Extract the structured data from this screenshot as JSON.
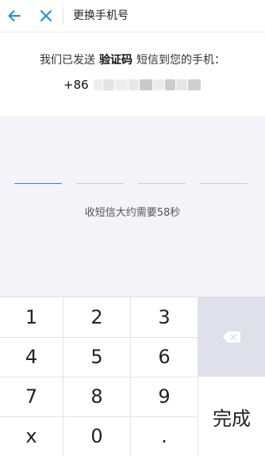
{
  "header": {
    "title": "更换手机号",
    "back_icon": "arrow-left-icon",
    "close_icon": "close-icon",
    "accent_color": "#1e8be0"
  },
  "info": {
    "text_before": "我们已发送",
    "text_bold": "验证码",
    "text_after": "短信到您的手机：",
    "phone_prefix": "+86"
  },
  "code": {
    "slot_count": 4,
    "active_index": 0,
    "countdown_text": "收短信大约需要58秒"
  },
  "keypad": {
    "rows": [
      [
        "1",
        "2",
        "3"
      ],
      [
        "4",
        "5",
        "6"
      ],
      [
        "7",
        "8",
        "9"
      ],
      [
        "x",
        "0",
        "."
      ]
    ],
    "delete_icon": "backspace-icon",
    "done_label": "完成"
  }
}
